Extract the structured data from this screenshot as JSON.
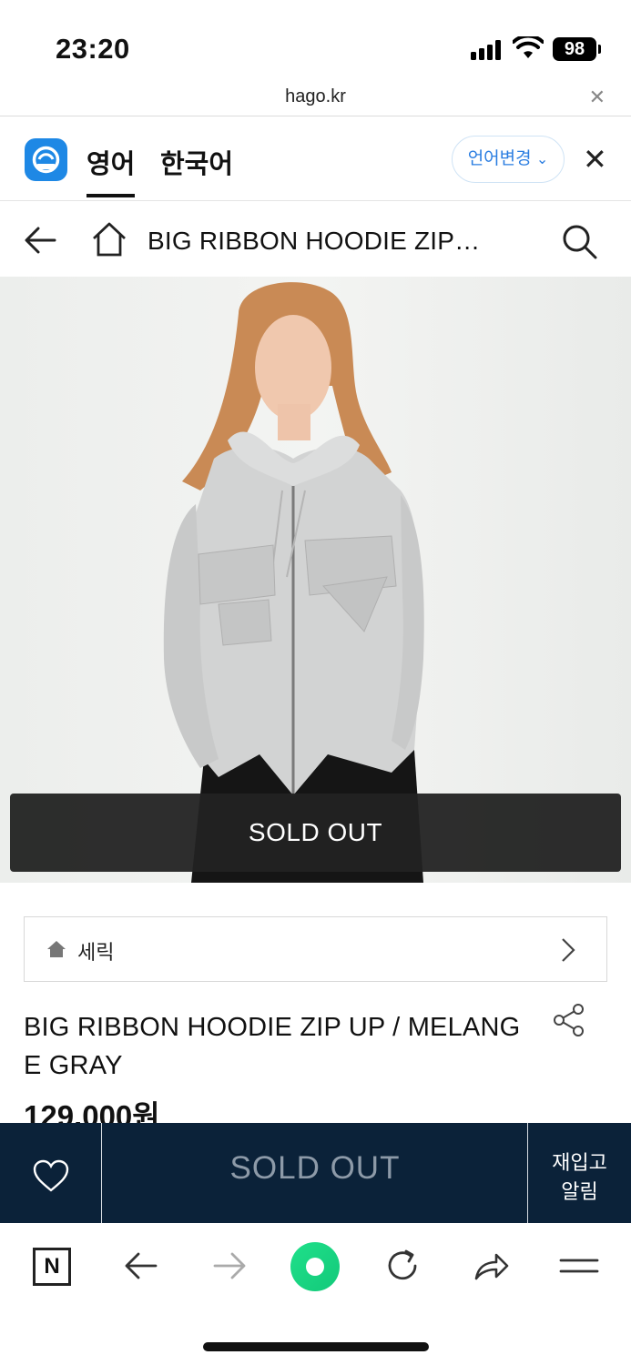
{
  "status_bar": {
    "time": "23:20",
    "battery": "98"
  },
  "url_bar": {
    "url": "hago.kr",
    "close_icon": "close-icon"
  },
  "translate_bar": {
    "tabs": [
      "영어",
      "한국어"
    ],
    "active_tab": "영어",
    "change_label": "언어변경",
    "close_label": "✕"
  },
  "nav": {
    "title": "BIG RIBBON HOODIE ZIP…"
  },
  "product": {
    "image_overlay": "SOLD OUT",
    "breadcrumb": "세릭",
    "title": "BIG RIBBON HOODIE ZIP UP / MELANGE GRAY",
    "price": "129,000원"
  },
  "purchase_bar": {
    "soldout_label": "SOLD OUT",
    "restock_line1": "재입고",
    "restock_line2": "알림"
  },
  "toolbar": {
    "n_label": "N"
  },
  "colors": {
    "purchase_bar_bg": "#0b2239",
    "translate_accent": "#2a7de1",
    "papago_blue": "#1e88e5",
    "toolbar_green": "#1fe08a"
  }
}
